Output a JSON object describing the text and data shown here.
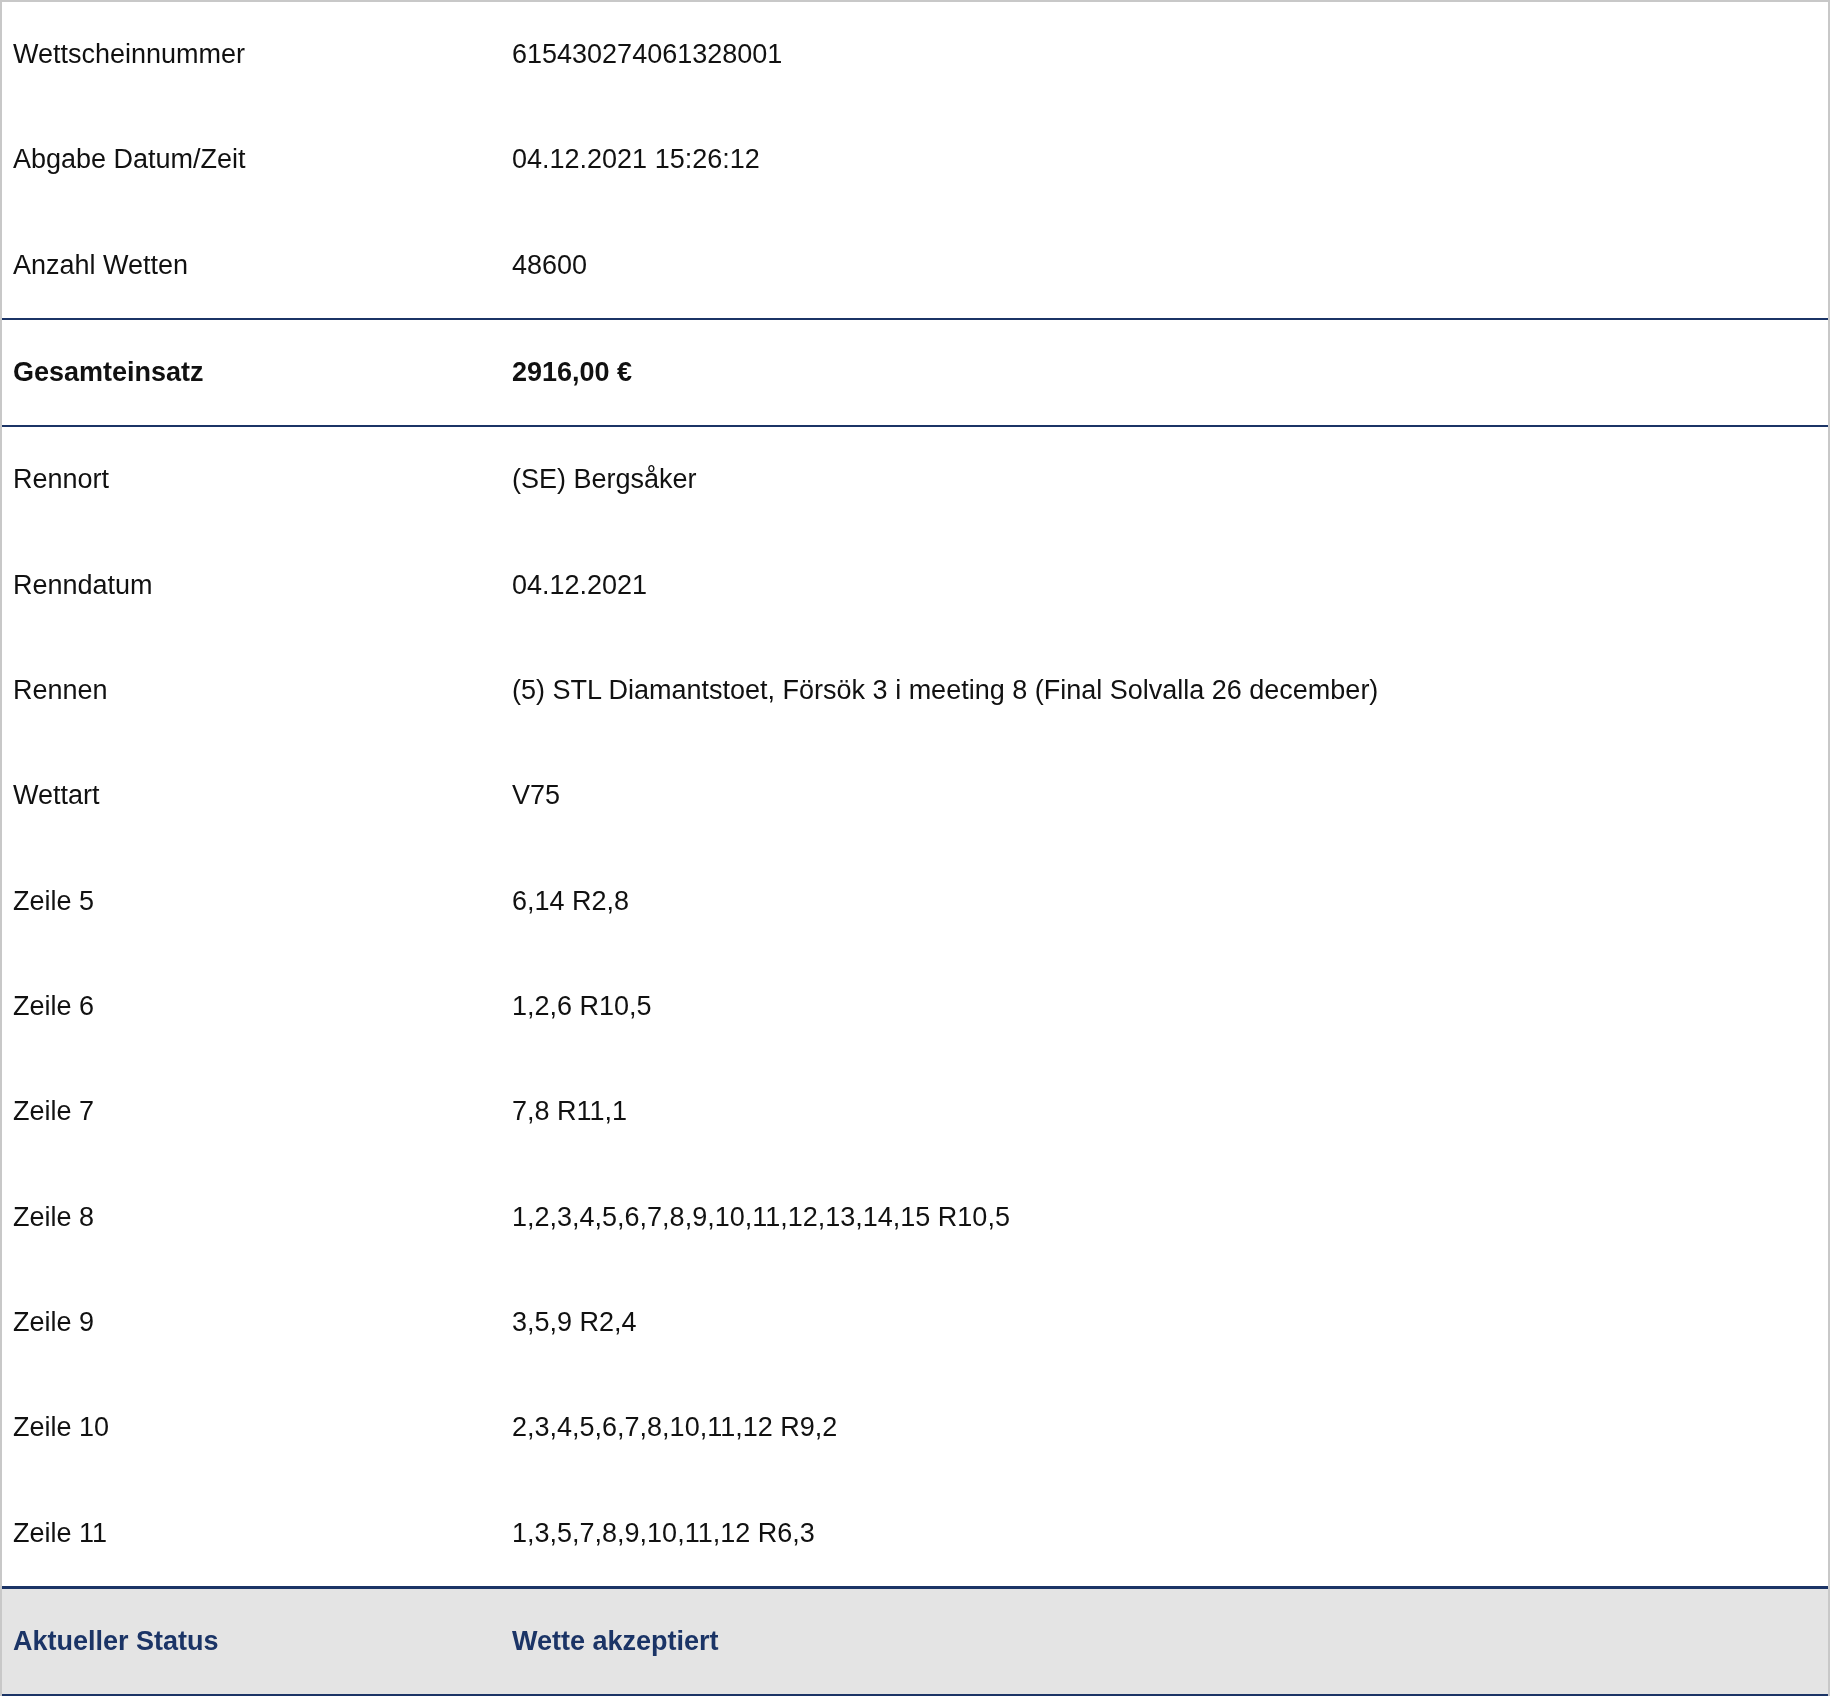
{
  "rows": [
    {
      "kind": "normal",
      "label": "Wettscheinnummer",
      "value": "615430274061328001"
    },
    {
      "kind": "normal",
      "label": "Abgabe Datum/Zeit",
      "value": "04.12.2021 15:26:12"
    },
    {
      "kind": "normal",
      "label": "Anzahl Wetten",
      "value": "48600"
    },
    {
      "kind": "total",
      "label": "Gesamteinsatz",
      "value": "2916,00 €"
    },
    {
      "kind": "normal",
      "label": "Rennort",
      "value": "(SE) Bergsåker"
    },
    {
      "kind": "normal",
      "label": "Renndatum",
      "value": "04.12.2021"
    },
    {
      "kind": "normal",
      "label": "Rennen",
      "value": "(5) STL Diamantstoet, Försök 3 i meeting 8 (Final Solvalla 26 december)"
    },
    {
      "kind": "normal",
      "label": "Wettart",
      "value": "V75"
    },
    {
      "kind": "normal",
      "label": "Zeile 5",
      "value": "6,14 R2,8"
    },
    {
      "kind": "normal",
      "label": "Zeile 6",
      "value": "1,2,6 R10,5"
    },
    {
      "kind": "normal",
      "label": "Zeile 7",
      "value": "7,8 R11,1"
    },
    {
      "kind": "normal",
      "label": "Zeile 8",
      "value": "1,2,3,4,5,6,7,8,9,10,11,12,13,14,15 R10,5"
    },
    {
      "kind": "normal",
      "label": "Zeile 9",
      "value": "3,5,9 R2,4"
    },
    {
      "kind": "normal",
      "label": "Zeile 10",
      "value": "2,3,4,5,6,7,8,10,11,12 R9,2"
    },
    {
      "kind": "normal",
      "label": "Zeile 11",
      "value": "1,3,5,7,8,9,10,11,12 R6,3"
    },
    {
      "kind": "status",
      "label": "Aktueller Status",
      "value": "Wette akzeptiert"
    }
  ]
}
